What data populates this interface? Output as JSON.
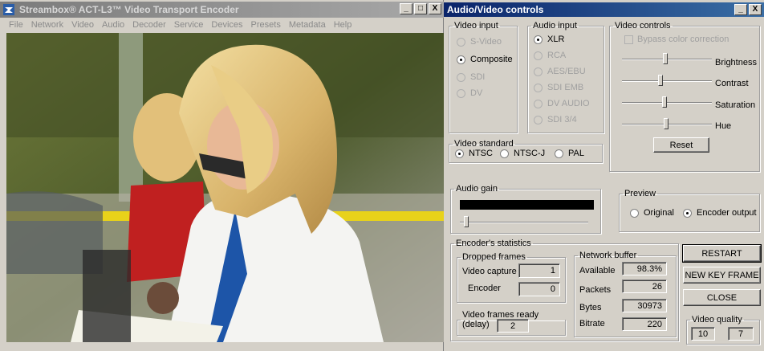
{
  "left_window": {
    "title": "Streambox® ACT-L3™ Video Transport Encoder",
    "menu": [
      "File",
      "Network",
      "Video",
      "Audio",
      "Decoder",
      "Service",
      "Devices",
      "Presets",
      "Metadata",
      "Help"
    ],
    "title_buttons": [
      "_",
      "□",
      "X"
    ]
  },
  "right_window": {
    "title": "Audio/Video controls",
    "title_buttons": [
      "_",
      "X"
    ],
    "video_input": {
      "legend": "Video input",
      "options": [
        {
          "label": "S-Video",
          "selected": false,
          "enabled": false
        },
        {
          "label": "Composite",
          "selected": true,
          "enabled": true
        },
        {
          "label": "SDI",
          "selected": false,
          "enabled": false
        },
        {
          "label": "DV",
          "selected": false,
          "enabled": false
        }
      ]
    },
    "audio_input": {
      "legend": "Audio input",
      "options": [
        {
          "label": "XLR",
          "selected": true,
          "enabled": true
        },
        {
          "label": "RCA",
          "selected": false,
          "enabled": false
        },
        {
          "label": "AES/EBU",
          "selected": false,
          "enabled": false
        },
        {
          "label": "SDI EMB",
          "selected": false,
          "enabled": false
        },
        {
          "label": "DV AUDIO",
          "selected": false,
          "enabled": false
        },
        {
          "label": "SDI 3/4",
          "selected": false,
          "enabled": false
        }
      ]
    },
    "video_controls": {
      "legend": "Video controls",
      "bypass_label": "Bypass color correction",
      "bypass_checked": false,
      "sliders": [
        {
          "label": "Brightness",
          "level": 0.48
        },
        {
          "label": "Contrast",
          "level": 0.42
        },
        {
          "label": "Saturation",
          "level": 0.47
        },
        {
          "label": "Hue",
          "level": 0.49
        }
      ],
      "reset_label": "Reset"
    },
    "video_standard": {
      "legend": "Video standard",
      "options": [
        {
          "label": "NTSC",
          "selected": true
        },
        {
          "label": "NTSC-J",
          "selected": false
        },
        {
          "label": "PAL",
          "selected": false
        }
      ]
    },
    "audio_gain": {
      "legend": "Audio gain",
      "level": 0.03
    },
    "preview": {
      "legend": "Preview",
      "options": [
        {
          "label": "Original",
          "selected": false
        },
        {
          "label": "Encoder output",
          "selected": true
        }
      ]
    },
    "stats": {
      "legend": "Encoder's statistics",
      "dropped_frames": {
        "legend": "Dropped frames",
        "video_capture_label": "Video capture",
        "video_capture_value": "1",
        "encoder_label": "Encoder",
        "encoder_value": "0"
      },
      "frames_ready": {
        "legend": "Video frames ready (delay)",
        "value": "2"
      },
      "network_buffer": {
        "legend": "Network buffer",
        "rows": [
          {
            "label": "Available",
            "value": "98.3%"
          },
          {
            "label": "Packets",
            "value": "26"
          },
          {
            "label": "Bytes",
            "value": "30973"
          },
          {
            "label": "Bitrate",
            "value": "220"
          }
        ]
      }
    },
    "buttons": {
      "restart": "RESTART",
      "new_key_frame": "NEW KEY FRAME",
      "close": "CLOSE"
    },
    "video_quality": {
      "legend": "Video quality",
      "value_1": "10",
      "value_2": "7"
    }
  }
}
